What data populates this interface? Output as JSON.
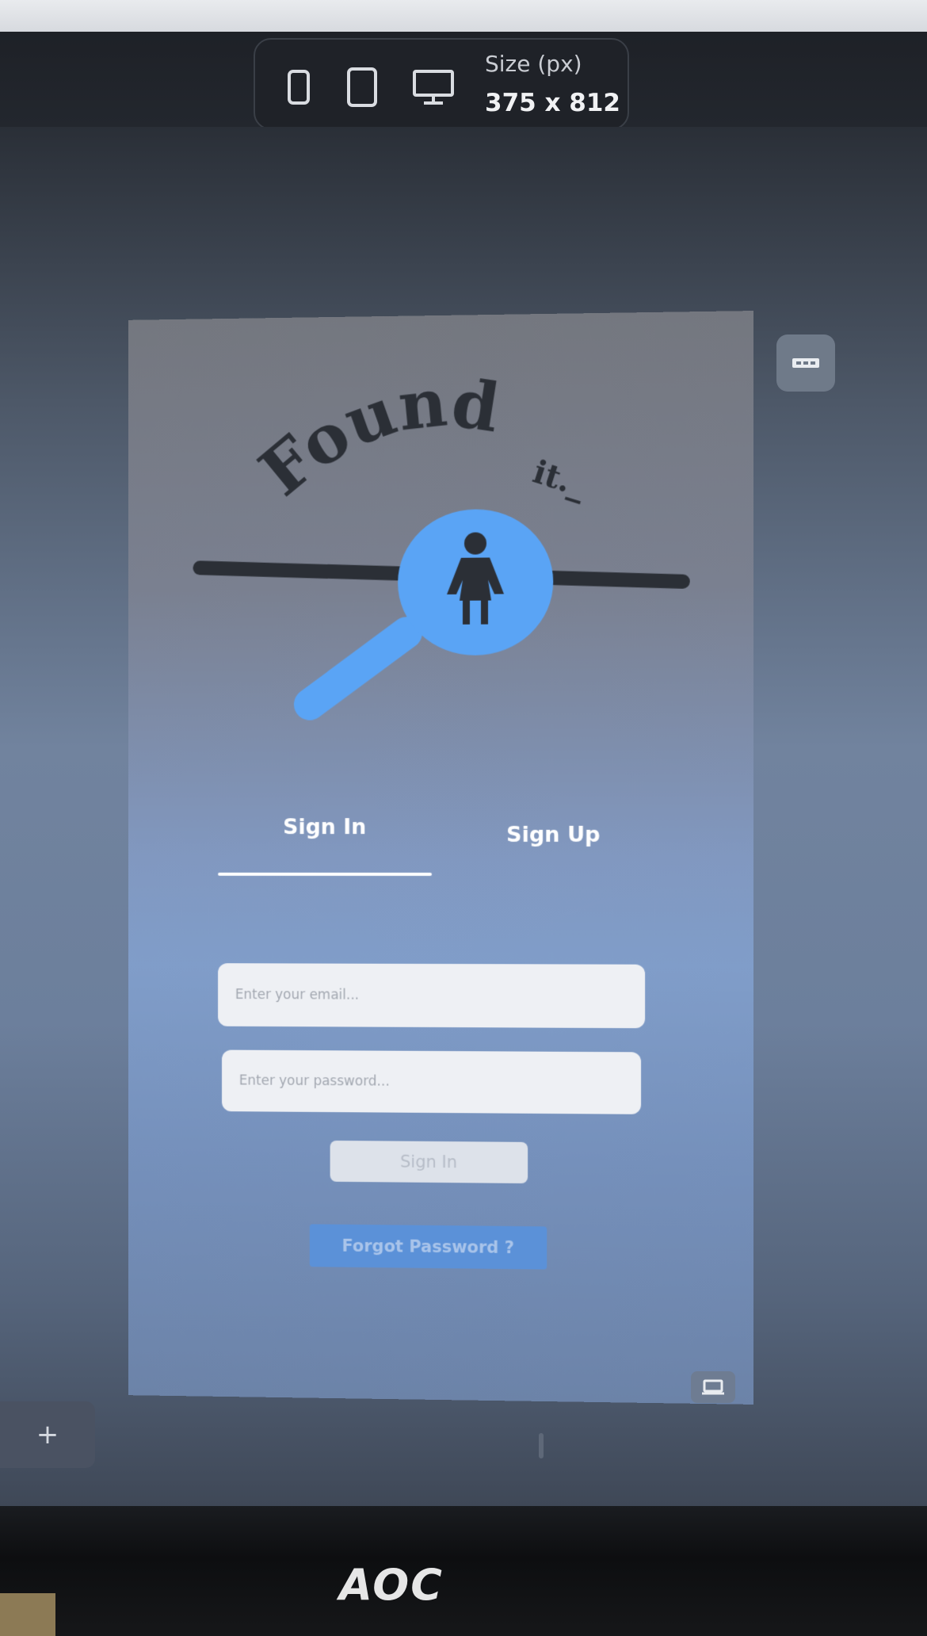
{
  "toolbar": {
    "size_label": "Size (px)",
    "size_value": "375 x 812",
    "devices": [
      "phone-icon",
      "tablet-icon",
      "desktop-icon"
    ]
  },
  "app": {
    "logo_text_main": "Found",
    "logo_text_tail": "it._",
    "tabs": [
      {
        "label": "Sign In",
        "active": true
      },
      {
        "label": "Sign Up",
        "active": false
      }
    ],
    "email_placeholder": "Enter your email...",
    "password_placeholder": "Enter your password...",
    "signin_button": "Sign In",
    "forgot_button": "Forgot Password ?",
    "colors": {
      "accent": "#5aa4f5",
      "dark": "#2b2f36"
    }
  },
  "canvas": {
    "add_label": "+",
    "side_top_icon": "keyboard-icon",
    "side_bottom_icon": "laptop-icon"
  },
  "monitor": {
    "brand": "AOC"
  }
}
